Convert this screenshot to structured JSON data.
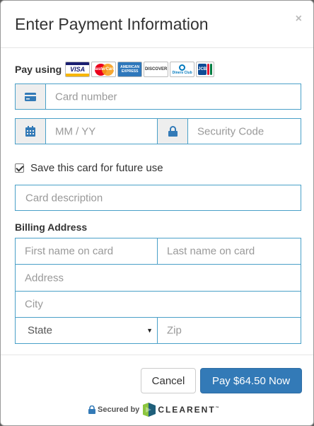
{
  "modal": {
    "title": "Enter Payment Information",
    "close_symbol": "×"
  },
  "payment": {
    "pay_using_label": "Pay using",
    "card_brands": [
      "VISA",
      "MasterCard",
      "AMERICAN EXPRESS",
      "DISCOVER",
      "Diners Club",
      "JCB"
    ],
    "card_number": {
      "placeholder": "Card number",
      "icon": "credit-card-icon"
    },
    "expiry": {
      "placeholder": "MM / YY",
      "icon": "calendar-icon"
    },
    "security_code": {
      "placeholder": "Security Code",
      "icon": "lock-icon"
    },
    "save_card": {
      "label": "Save this card for future use",
      "checked": true
    },
    "card_description": {
      "placeholder": "Card description"
    }
  },
  "billing": {
    "title": "Billing Address",
    "first_name": {
      "placeholder": "First name on card"
    },
    "last_name": {
      "placeholder": "Last name on card"
    },
    "address": {
      "placeholder": "Address"
    },
    "city": {
      "placeholder": "City"
    },
    "state": {
      "selected": "State",
      "options": [
        "State"
      ]
    },
    "zip": {
      "placeholder": "Zip"
    }
  },
  "footer": {
    "cancel_label": "Cancel",
    "pay_label": "Pay $64.50 Now",
    "secured_by": "Secured by",
    "brand": "CLEARENT",
    "trademark": "™"
  },
  "colors": {
    "accent": "#337ab7",
    "field_border": "#4aa0c8",
    "brand_green": "#8dc63f"
  }
}
